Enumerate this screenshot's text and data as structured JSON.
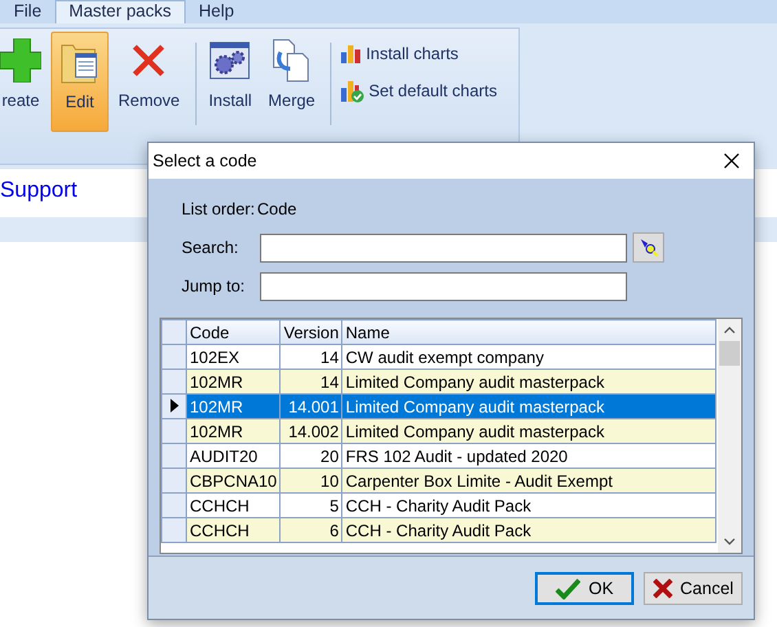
{
  "menu_tabs": [
    {
      "label": "File",
      "selected": false
    },
    {
      "label": "Master packs",
      "selected": true
    },
    {
      "label": "Help",
      "selected": false
    }
  ],
  "ribbon": {
    "buttons": [
      {
        "kind": "create",
        "label": "reate",
        "selected": false
      },
      {
        "kind": "edit",
        "label": "Edit",
        "selected": true
      },
      {
        "kind": "remove",
        "label": "Remove",
        "selected": false
      },
      {
        "kind": "install",
        "label": "Install",
        "selected": false
      },
      {
        "kind": "merge",
        "label": "Merge",
        "selected": false
      }
    ],
    "small_buttons": [
      {
        "kind": "charts",
        "label": "Install charts"
      },
      {
        "kind": "default",
        "label": "Set default charts"
      }
    ]
  },
  "page_heading": "Support",
  "dialog": {
    "title": "Select a code",
    "list_order_label": "List order:",
    "list_order_value": "Code",
    "search_label": "Search:",
    "jump_label": "Jump to:",
    "table": {
      "columns": [
        "Code",
        "Version",
        "Name"
      ],
      "rows": [
        {
          "cells": [
            "102EX",
            "14",
            "CW audit exempt company"
          ],
          "selected": false
        },
        {
          "cells": [
            "102MR",
            "14",
            "Limited Company audit masterpack"
          ],
          "selected": false
        },
        {
          "cells": [
            "102MR",
            "14.001",
            "Limited Company audit masterpack"
          ],
          "selected": true
        },
        {
          "cells": [
            "102MR",
            "14.002",
            "Limited Company audit masterpack"
          ],
          "selected": false
        },
        {
          "cells": [
            "AUDIT20",
            "20",
            "FRS 102 Audit - updated 2020"
          ],
          "selected": false
        },
        {
          "cells": [
            "CBPCNA10",
            "10",
            "Carpenter Box Limite - Audit Exempt"
          ],
          "selected": false
        },
        {
          "cells": [
            "CCHCH",
            "5",
            "CCH - Charity Audit Pack"
          ],
          "selected": false
        },
        {
          "cells": [
            "CCHCH",
            "6",
            "CCH - Charity Audit Pack"
          ],
          "selected": false
        }
      ]
    },
    "buttons": [
      {
        "kind": "ok",
        "label": "OK"
      },
      {
        "kind": "cancel",
        "label": "Cancel"
      }
    ]
  }
}
